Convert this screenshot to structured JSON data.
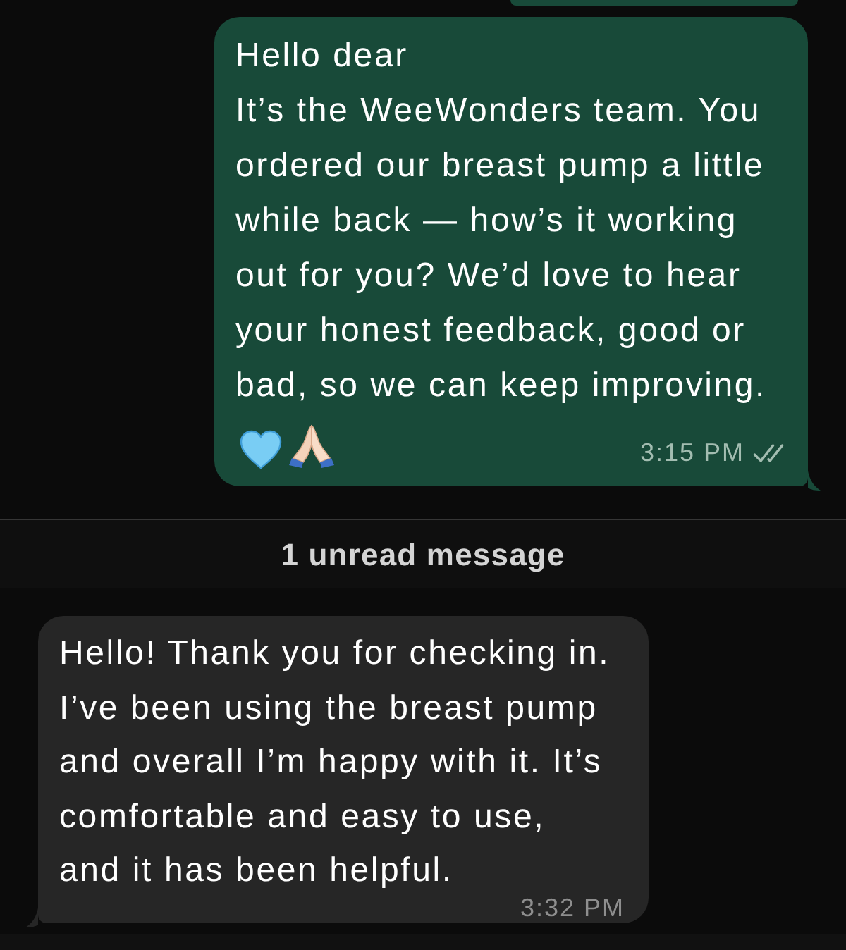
{
  "messages": [
    {
      "kind": "outgoing",
      "text": "Hello dear\nIt’s the WeeWonders team. You\nordered our breast pump a little\nwhile back — how’s it working\nout for you? We’d love to hear\nyour honest feedback, good or\nbad, so we can keep improving.",
      "emojis": [
        {
          "kind": "heart"
        },
        {
          "kind": "folded_hands"
        }
      ],
      "time": "3:15 PM",
      "read": false
    },
    {
      "kind": "unread_divider",
      "label": "1 unread message"
    },
    {
      "kind": "incoming",
      "text": "Hello! Thank you for checking in.\nI’ve been using the breast pump\nand overall I’m happy with it. It’s\ncomfortable and easy to use,\nand it has been helpful.",
      "time": "3:32 PM"
    }
  ]
}
